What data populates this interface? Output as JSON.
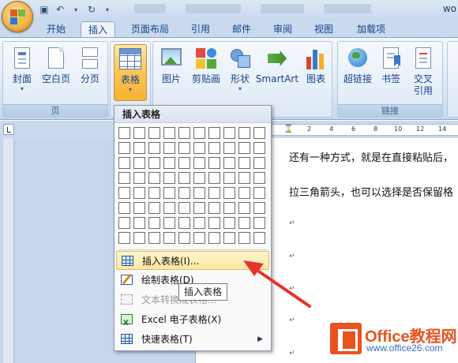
{
  "window": {
    "title": "wo"
  },
  "tabs": [
    "开始",
    "插入",
    "页面布局",
    "引用",
    "邮件",
    "审阅",
    "视图",
    "加载项"
  ],
  "active_tab": "插入",
  "ribbon": {
    "groups": [
      {
        "label": "页",
        "buttons": [
          "封面",
          "空白页",
          "分页"
        ]
      },
      {
        "label": "",
        "buttons": [
          "表格"
        ]
      },
      {
        "label": "",
        "buttons": [
          "图片",
          "剪贴画",
          "形状",
          "SmartArt",
          "图表"
        ]
      },
      {
        "label": "链接",
        "buttons": [
          "超链接",
          "书签",
          "交叉引用"
        ]
      }
    ],
    "cross_ref_line1": "交叉",
    "cross_ref_line2": "引用"
  },
  "ruler": {
    "ticks": [
      "2",
      "4",
      "6",
      "8",
      "10",
      "12",
      "14"
    ]
  },
  "document": {
    "lines": [
      "还有一种方式，就是在直接粘贴后，",
      "拉三角箭头，也可以选择是否保留格"
    ],
    "paragraph_mark": "↵"
  },
  "table_menu": {
    "header": "插入表格",
    "grid_cols": 10,
    "grid_rows": 8,
    "items": [
      {
        "label": "插入表格(I)...",
        "icon": "table-grid-icon",
        "state": "hover"
      },
      {
        "label": "绘制表格(D)",
        "icon": "draw-table-icon",
        "state": "normal"
      },
      {
        "label": "文本转换成表格...",
        "icon": "convert-text-icon",
        "state": "disabled"
      },
      {
        "label": "Excel 电子表格(X)",
        "icon": "excel-sheet-icon",
        "state": "normal"
      },
      {
        "label": "快速表格(T)",
        "icon": "quick-table-icon",
        "state": "normal",
        "submenu": true
      }
    ]
  },
  "tooltip": "插入表格",
  "watermark": {
    "brand": "Office教程网",
    "url": "www.office26.com"
  },
  "colors": {
    "ribbon_bg": "#dbe6f4",
    "tab_text": "#15428b",
    "hover_highlight": "#fde7a3",
    "annotation_arrow": "#e8322c",
    "watermark_orange": "#e8531e"
  }
}
